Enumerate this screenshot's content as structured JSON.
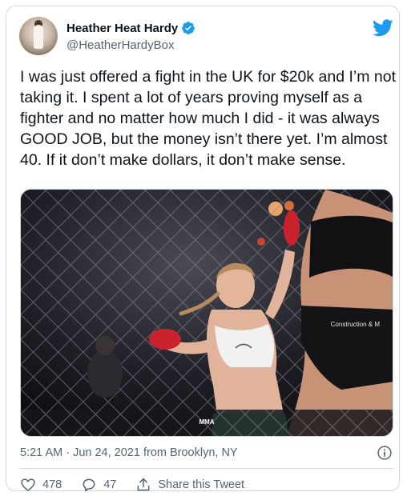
{
  "author": {
    "name": "Heather Heat Hardy",
    "handle": "@HeatherHardyBox",
    "verified": true,
    "avatar_icon": "profile-photo"
  },
  "tweet": {
    "text": "I was just offered a fight in the UK for $20k and I’m not taking it. I spent a lot of years proving myself as a fighter and no matter how much I did - it was always GOOD JOB, but the money isn’t there yet. I’m almost 40. If it don’t make dollars, it don’t make sense.",
    "timestamp": "5:21 AM · Jun 24, 2021 from Brooklyn, NY"
  },
  "media": {
    "watermark": "MMA",
    "banner_text": "Construction & M"
  },
  "actions": {
    "like_count": "478",
    "reply_count": "47",
    "share_label": "Share this Tweet"
  },
  "colors": {
    "brand_blue": "#1d9bf0",
    "text_primary": "#0f1419",
    "text_secondary": "#536471",
    "border": "#cfd9de"
  }
}
